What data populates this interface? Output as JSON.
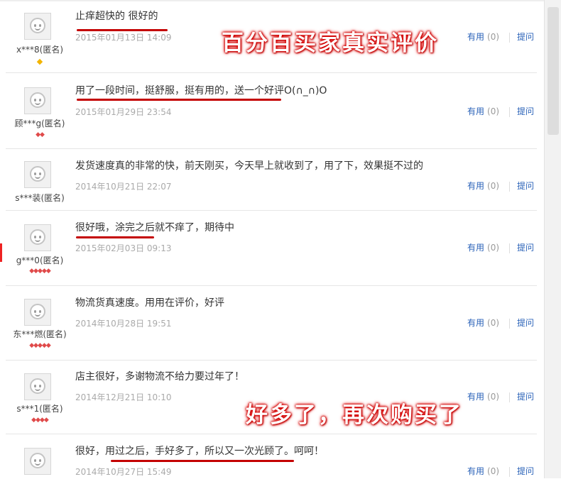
{
  "reviews": [
    {
      "user": "x***8(匿名)",
      "content": "止痒超快的 很好的",
      "date": "2015年01月13日 14:09",
      "badge": "◆",
      "useful": "有用",
      "count": "(0)",
      "ask": "提问"
    },
    {
      "user": "顾***g(匿名)",
      "content": "用了一段时间，挺舒服，挺有用的，送一个好评O(∩_∩)O",
      "date": "2015年01月29日 23:54",
      "badge": "◆◆",
      "useful": "有用",
      "count": "(0)",
      "ask": "提问"
    },
    {
      "user": "s***装(匿名)",
      "content": "发货速度真的非常的快，前天刚买，今天早上就收到了，用了下，效果挺不过的",
      "date": "2014年10月21日 22:07",
      "badge": "",
      "useful": "有用",
      "count": "(0)",
      "ask": "提问"
    },
    {
      "user": "g***0(匿名)",
      "content": "很好哦，涂完之后就不痒了，期待中",
      "date": "2015年02月03日 09:13",
      "badge": "◆◆◆◆◆",
      "useful": "有用",
      "count": "(0)",
      "ask": "提问"
    },
    {
      "user": "东***燃(匿名)",
      "content": "物流货真速度。用用在评价，好评",
      "date": "2014年10月28日 19:51",
      "badge": "◆◆◆◆◆",
      "useful": "有用",
      "count": "(0)",
      "ask": "提问"
    },
    {
      "user": "s***1(匿名)",
      "content": "店主很好，多谢物流不给力要过年了！",
      "date": "2014年12月21日 10:10",
      "badge": "◆◆◆◆",
      "useful": "有用",
      "count": "(0)",
      "ask": "提问"
    },
    {
      "user": "",
      "content": "很好，用过之后，手好多了，所以又一次光顾了。呵呵！",
      "date": "2014年10月27日 15:49",
      "badge": "",
      "useful": "有用",
      "count": "(0)",
      "ask": "提问"
    }
  ],
  "overlays": {
    "top": "百分百买家真实评价",
    "bottom": "好多了，再次购买了"
  },
  "colors": {
    "link": "#2a62b8",
    "underline": "#c40000",
    "overlay_glow": "#d30000"
  }
}
